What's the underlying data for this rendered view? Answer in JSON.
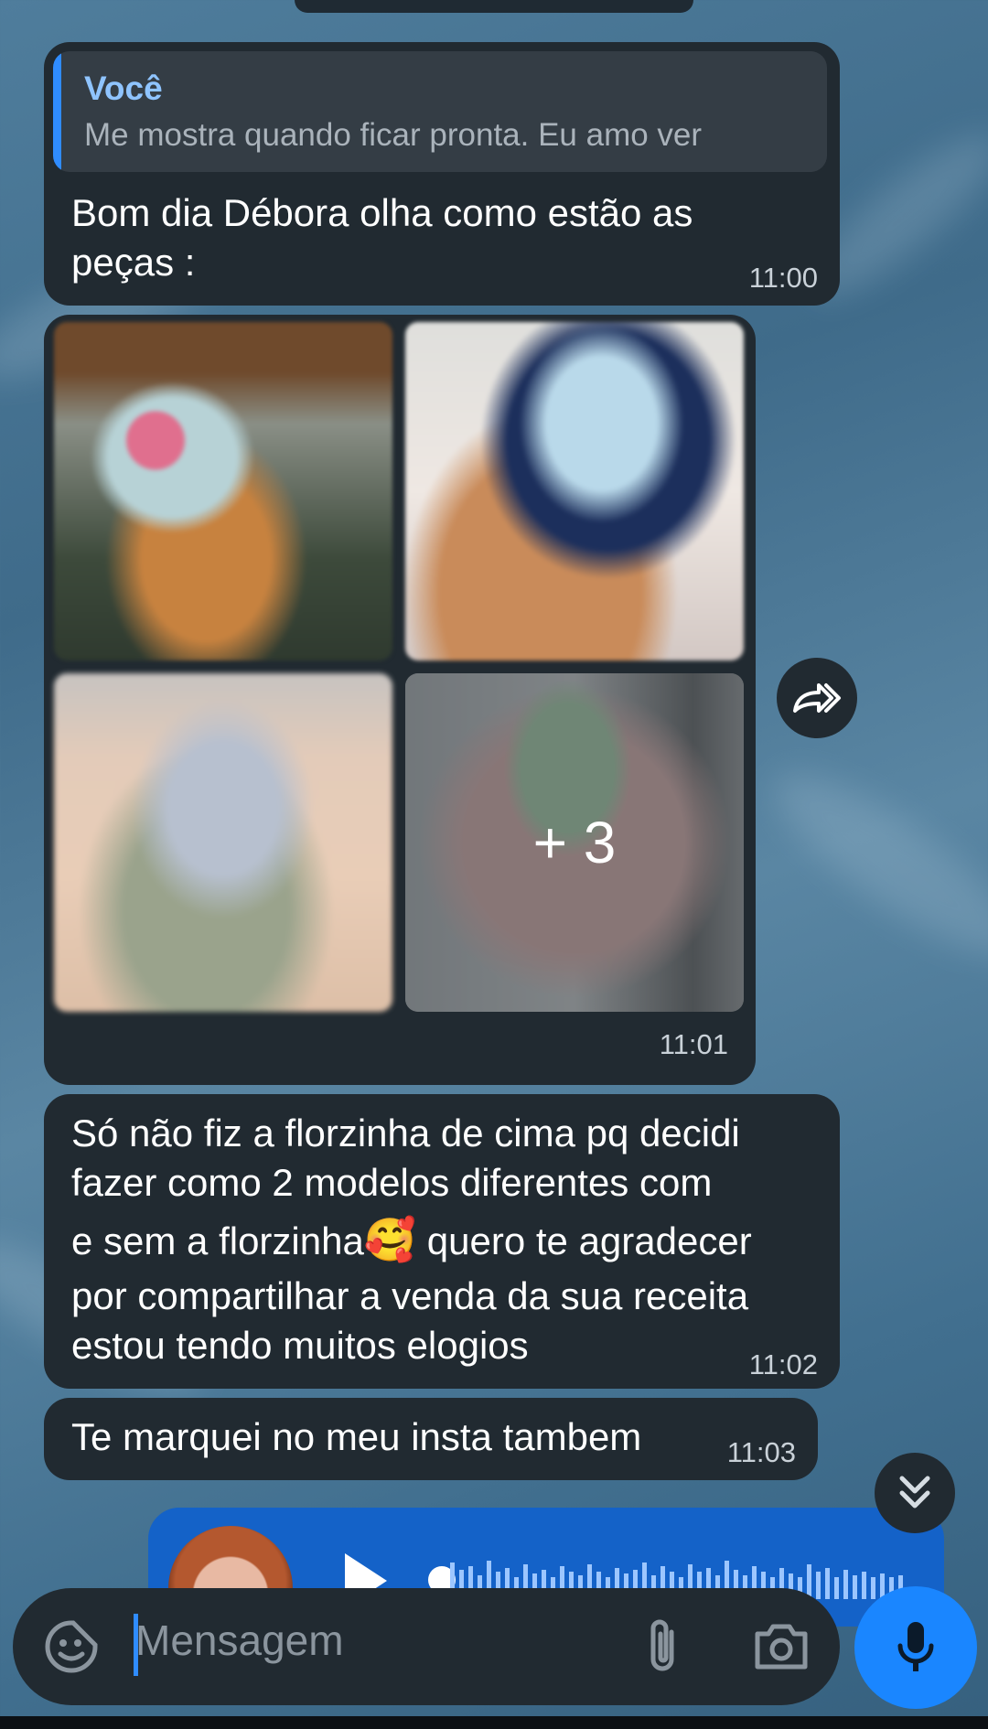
{
  "messages": {
    "m1": {
      "reply_author": "Você",
      "reply_text": "Me mostra quando ficar pronta. Eu amo ver",
      "text_line1": "Bom dia Débora olha como estão as",
      "text_line2": "peças :",
      "time": "11:00"
    },
    "album": {
      "more_count_label": "+ 3",
      "time": "11:01"
    },
    "m3": {
      "line1": "Só não fiz a florzinha de cima pq decidi",
      "line2": "fazer como 2 modelos diferentes com",
      "line3a": "e sem a florzinha",
      "emoji": "🥰",
      "line3b": " quero te agradecer",
      "line4": "por compartilhar a venda da sua receita",
      "line5": "estou tendo muitos elogios",
      "time": "11:02"
    },
    "m4": {
      "text": "Te marquei no meu insta tambem",
      "time": "11:03"
    }
  },
  "composer": {
    "placeholder": "Mensagem"
  },
  "icons": {
    "forward": "forward-icon",
    "scroll_down": "double-chevron-down-icon",
    "sticker": "sticker-icon",
    "attach": "paperclip-icon",
    "camera": "camera-icon",
    "mic": "microphone-icon",
    "play": "play-icon"
  },
  "colors": {
    "bubble": "#212a31",
    "accent": "#1a86ff",
    "outgoing": "#1462c8",
    "reply_author": "#8fc4ff"
  }
}
